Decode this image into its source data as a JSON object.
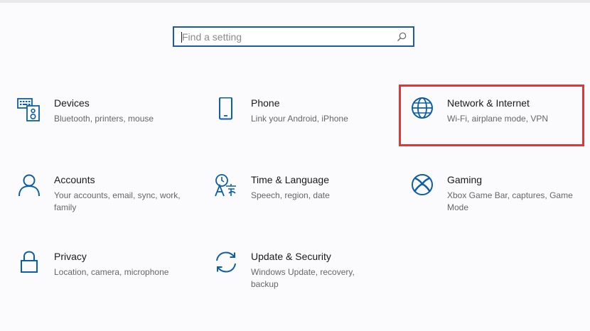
{
  "colors": {
    "accent": "#0b5ea8",
    "highlight": "#e03636",
    "search_border": "#1a5aa6"
  },
  "search": {
    "placeholder": "Find a setting",
    "icon": "search-icon"
  },
  "tiles": [
    {
      "title": "Devices",
      "desc": "Bluetooth, printers, mouse",
      "icon": "devices-icon"
    },
    {
      "title": "Phone",
      "desc": "Link your Android, iPhone",
      "icon": "phone-icon"
    },
    {
      "title": "Network & Internet",
      "desc": "Wi-Fi, airplane mode, VPN",
      "icon": "globe-icon",
      "highlighted": true
    },
    {
      "title": "Accounts",
      "desc": "Your accounts, email, sync, work, family",
      "icon": "person-icon"
    },
    {
      "title": "Time & Language",
      "desc": "Speech, region, date",
      "icon": "time-language-icon"
    },
    {
      "title": "Gaming",
      "desc": "Xbox Game Bar, captures, Game Mode",
      "icon": "xbox-icon"
    },
    {
      "title": "Privacy",
      "desc": "Location, camera, microphone",
      "icon": "lock-icon"
    },
    {
      "title": "Update & Security",
      "desc": "Windows Update, recovery, backup",
      "icon": "sync-icon"
    }
  ]
}
